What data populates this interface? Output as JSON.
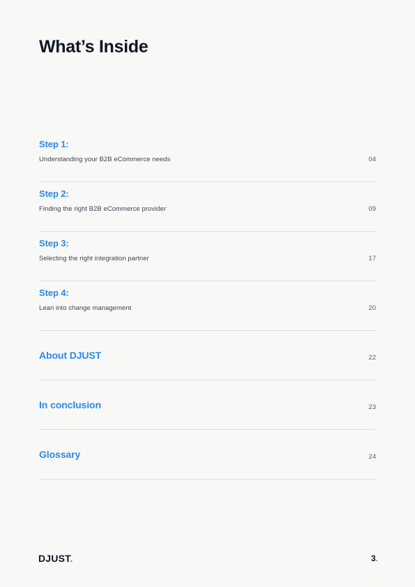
{
  "document": {
    "title": "What’s Inside",
    "background_color": "#f8f8f7",
    "accent_color": "#2b8ae8",
    "heading_color": "#0f1724"
  },
  "toc": {
    "entries": [
      {
        "type": "step",
        "heading": "Step 1:",
        "subtitle": "Understanding your B2B eCommerce needs",
        "page": "04"
      },
      {
        "type": "step",
        "heading": "Step 2:",
        "subtitle": "Finding the right B2B eCommerce provider",
        "page": "09"
      },
      {
        "type": "step",
        "heading": "Step 3:",
        "subtitle": "Selecting the right integration partner",
        "page": "17"
      },
      {
        "type": "step",
        "heading": "Step 4:",
        "subtitle": "Lean into change management",
        "page": "20"
      },
      {
        "type": "plain",
        "heading": "About DJUST",
        "page": "22"
      },
      {
        "type": "plain",
        "heading": "In conclusion",
        "page": "23"
      },
      {
        "type": "plain",
        "heading": "Glossary",
        "page": "24"
      }
    ]
  },
  "footer": {
    "logo_text": "DJUST",
    "logo_dot": ".",
    "page_number": "3",
    "page_number_dot": "."
  }
}
